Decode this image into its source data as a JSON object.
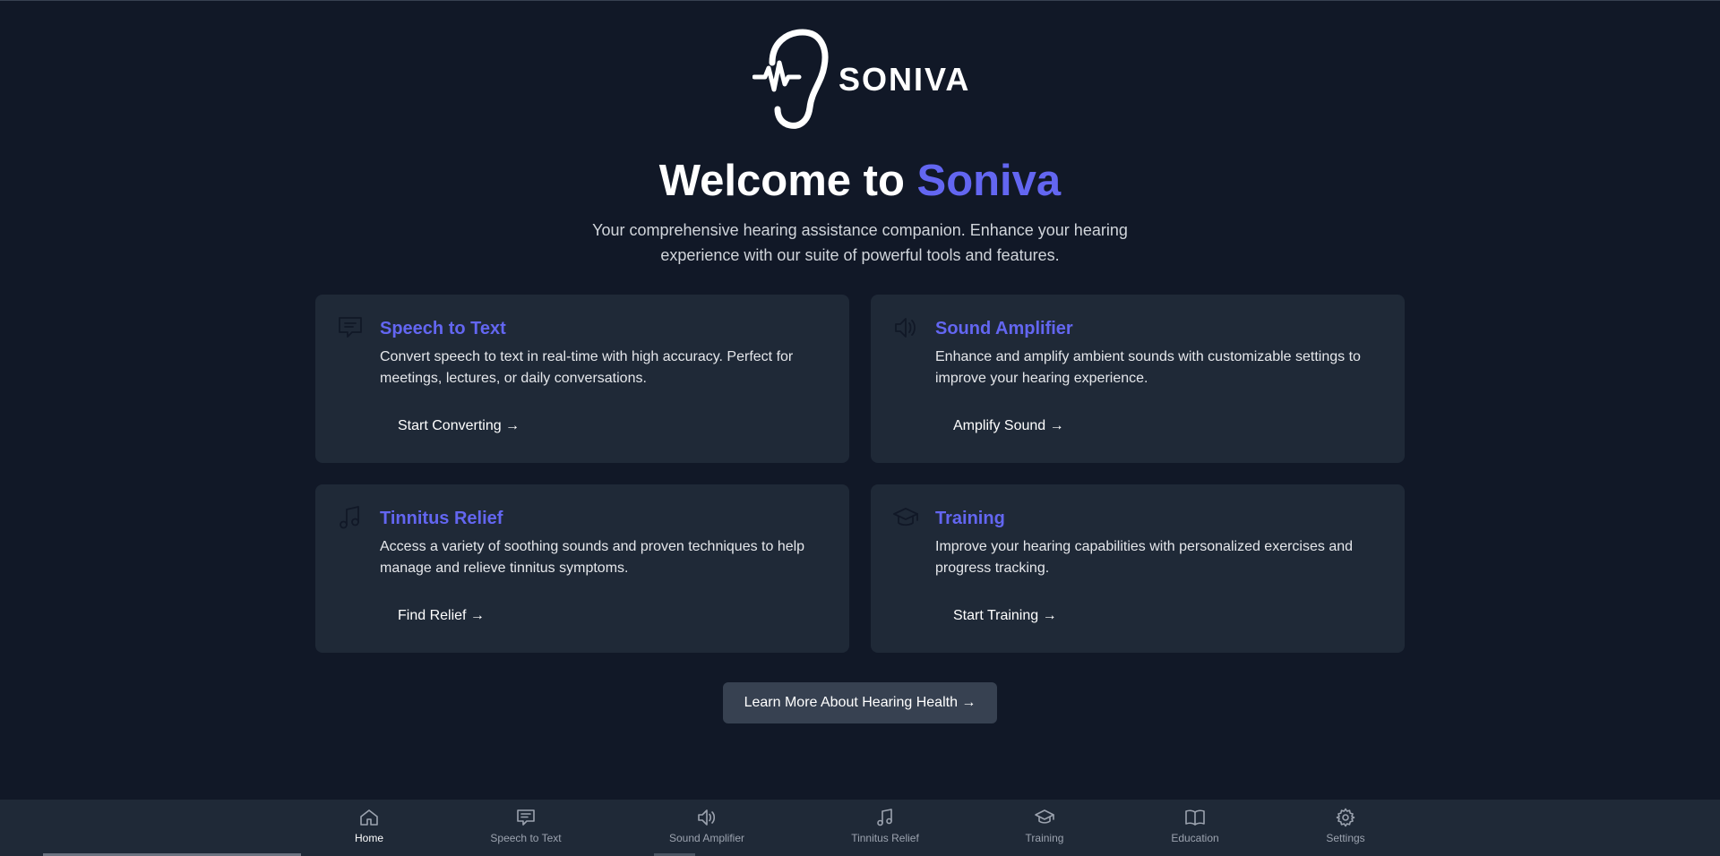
{
  "brand": {
    "name": "SONIVA",
    "accent_color": "#6366f1",
    "logo_icon": "ear-waveform-icon"
  },
  "hero": {
    "title_prefix": "Welcome to ",
    "title_accent": "Soniva",
    "subtitle": "Your comprehensive hearing assistance companion. Enhance your hearing experience with our suite of powerful tools and features."
  },
  "cards": [
    {
      "icon": "chat-bubble-icon",
      "title": "Speech to Text",
      "description": "Convert speech to text in real-time with high accuracy. Perfect for meetings, lectures, or daily conversations.",
      "link": "Start Converting →"
    },
    {
      "icon": "speaker-icon",
      "title": "Sound Amplifier",
      "description": "Enhance and amplify ambient sounds with customizable settings to improve your hearing experience.",
      "link": "Amplify Sound →"
    },
    {
      "icon": "music-note-icon",
      "title": "Tinnitus Relief",
      "description": "Access a variety of soothing sounds and proven techniques to help manage and relieve tinnitus symptoms.",
      "link": "Find Relief →"
    },
    {
      "icon": "graduation-cap-icon",
      "title": "Training",
      "description": "Improve your hearing capabilities with personalized exercises and progress tracking.",
      "link": "Start Training →"
    }
  ],
  "cta": {
    "label": "Learn More About Hearing Health →"
  },
  "nav": {
    "active": "Home",
    "items": [
      {
        "label": "Home",
        "icon": "home-icon"
      },
      {
        "label": "Speech to Text",
        "icon": "chat-bubble-icon"
      },
      {
        "label": "Sound Amplifier",
        "icon": "speaker-icon"
      },
      {
        "label": "Tinnitus Relief",
        "icon": "music-note-icon"
      },
      {
        "label": "Training",
        "icon": "graduation-cap-icon"
      },
      {
        "label": "Education",
        "icon": "book-icon"
      },
      {
        "label": "Settings",
        "icon": "gear-icon"
      }
    ]
  }
}
